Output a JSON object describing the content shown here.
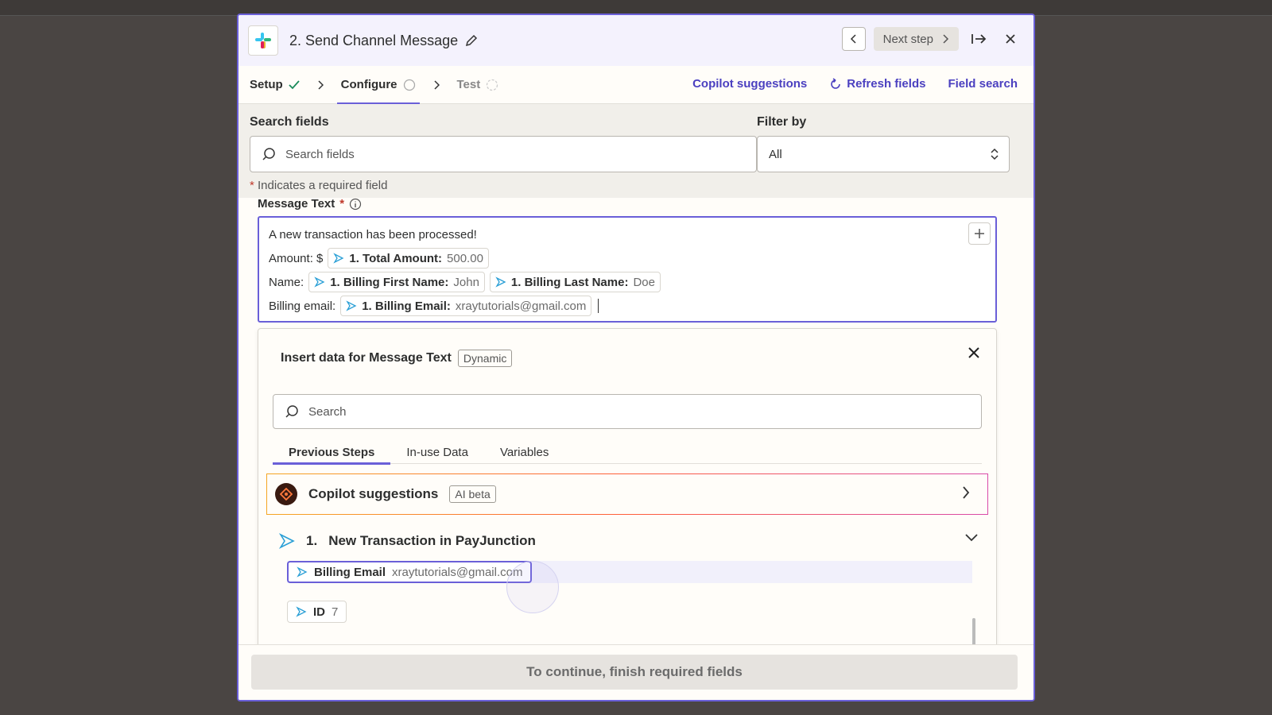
{
  "header": {
    "title": "2. Send Channel Message",
    "next_step_label": "Next step"
  },
  "tabs": {
    "setup": "Setup",
    "configure": "Configure",
    "test": "Test",
    "copilot": "Copilot suggestions",
    "refresh": "Refresh fields",
    "field_search": "Field search"
  },
  "search": {
    "label": "Search fields",
    "placeholder": "Search fields",
    "filter_label": "Filter by",
    "filter_value": "All",
    "required_note": "Indicates a required field"
  },
  "message": {
    "label": "Message Text",
    "line1": "A new transaction has been processed!",
    "line2_prefix": "Amount: $",
    "amount_pill_name": "1. Total Amount:",
    "amount_pill_value": "500.00",
    "line3_prefix": "Name:",
    "first_name_pill_name": "1. Billing First Name:",
    "first_name_pill_value": "John",
    "last_name_pill_name": "1. Billing Last Name:",
    "last_name_pill_value": "Doe",
    "line4_prefix": "Billing email:",
    "email_pill_name": "1. Billing Email:",
    "email_pill_value": "xraytutorials@gmail.com"
  },
  "insert_panel": {
    "title": "Insert data for Message Text",
    "badge": "Dynamic",
    "search_placeholder": "Search",
    "tabs": [
      "Previous Steps",
      "In-use Data",
      "Variables"
    ],
    "copilot_title": "Copilot suggestions",
    "copilot_badge": "AI beta",
    "step_number": "1.",
    "step_title": "New Transaction in PayJunction",
    "items": [
      {
        "name": "Billing Email",
        "value": "xraytutorials@gmail.com"
      },
      {
        "name": "ID",
        "value": "7"
      }
    ]
  },
  "footer": {
    "continue_label": "To continue, finish required fields"
  },
  "colors": {
    "accent": "#6a5fd8",
    "link": "#4b40c0",
    "required": "#c0392b"
  }
}
